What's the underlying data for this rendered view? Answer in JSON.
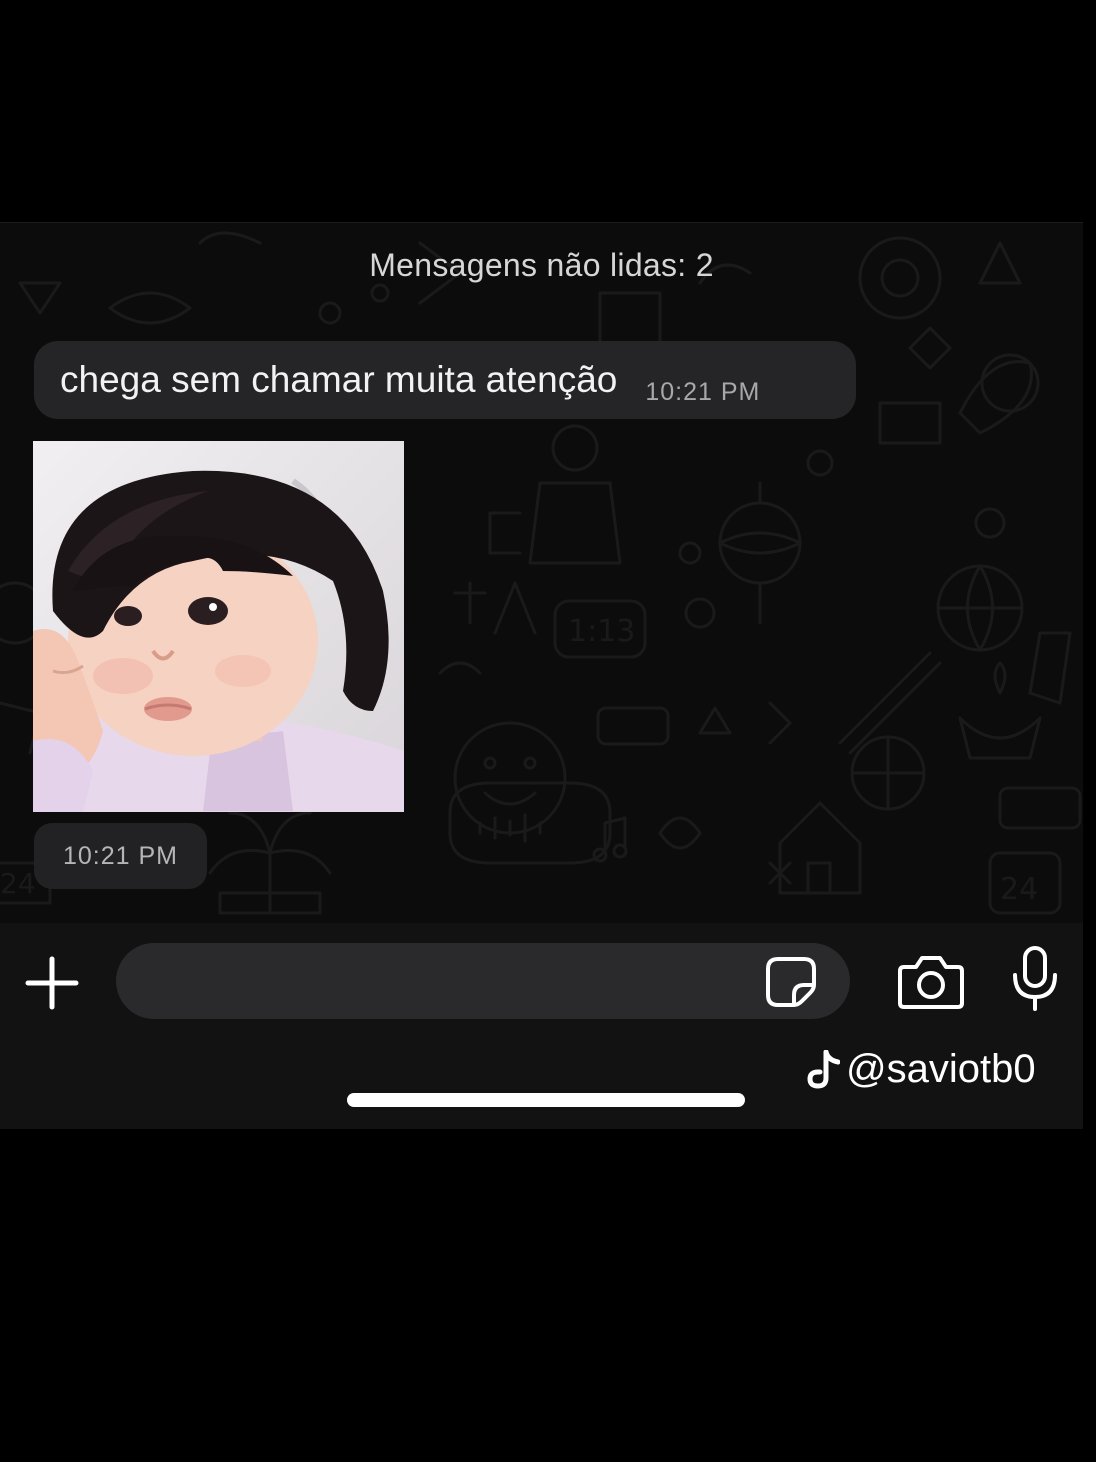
{
  "chat": {
    "unread_divider": "Mensagens não lidas: 2",
    "messages": [
      {
        "type": "text",
        "text": "chega sem chamar muita atenção",
        "time": "10:21 PM"
      },
      {
        "type": "image",
        "image_icon": "photo-of-child-resting-chin-on-hand",
        "time": "10:21 PM"
      }
    ]
  },
  "input_bar": {
    "plus_icon": "plus-icon",
    "sticker_icon": "sticker-icon",
    "camera_icon": "camera-icon",
    "mic_icon": "microphone-icon",
    "placeholder": ""
  },
  "watermark": {
    "icon": "tiktok-note-icon",
    "handle": "@saviotb0"
  },
  "colors": {
    "background": "#000000",
    "chat_bg": "#0c0c0c",
    "bubble": "#252527",
    "input_field": "#2a2a2c",
    "text_primary": "#f2f2f2",
    "text_secondary": "#a8a8a8"
  }
}
